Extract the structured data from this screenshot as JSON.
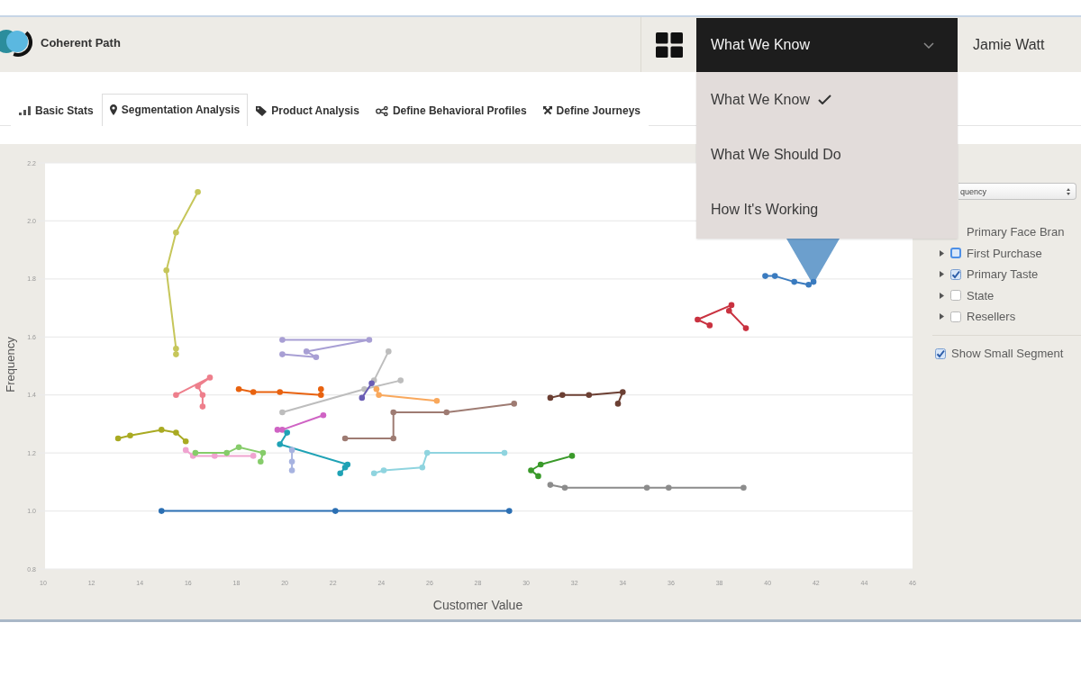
{
  "header": {
    "app_name": "Coherent Path",
    "view_menu": {
      "label": "What We Know",
      "expanded": true,
      "items": [
        {
          "label": "What We Know",
          "selected": true
        },
        {
          "label": "What We Should Do",
          "selected": false
        },
        {
          "label": "How It's Working",
          "selected": false
        }
      ]
    },
    "user_name": "Jamie Watt"
  },
  "tabs": [
    {
      "label": "Basic Stats",
      "selected": false
    },
    {
      "label": "Segmentation Analysis",
      "selected": true
    },
    {
      "label": "Product Analysis",
      "selected": false
    },
    {
      "label": "Define Behavioral Profiles",
      "selected": false
    },
    {
      "label": "Define Journeys",
      "selected": false
    }
  ],
  "chart": {
    "chart_data": {
      "type": "line",
      "xlabel": "Customer Value",
      "ylabel": "Frequency",
      "grid": true,
      "xlim": [
        10,
        46
      ],
      "ylim": [
        0.8,
        2.2
      ],
      "xticks": [
        10,
        12,
        14,
        16,
        18,
        20,
        22,
        24,
        26,
        28,
        30,
        32,
        34,
        36,
        38,
        40,
        42,
        44,
        46
      ],
      "yticks": [
        {
          "value": 0.8,
          "label": "0.8"
        },
        {
          "value": 1.0,
          "label": "1.0"
        },
        {
          "value": 1.2,
          "label": "1.2"
        },
        {
          "value": 1.4,
          "label": "1.4"
        },
        {
          "value": 1.6,
          "label": "1.6"
        },
        {
          "value": 1.8,
          "label": "1.8"
        },
        {
          "value": 2.0,
          "label": "2.0"
        },
        {
          "value": 2.2,
          "label": "2.2"
        }
      ],
      "series": [
        {
          "color": "#c6c65a",
          "marker": "circle",
          "x": [
            16.4,
            15.5,
            15.1,
            15.5,
            15.5
          ],
          "values": [
            2.1,
            1.96,
            1.83,
            1.56,
            1.54
          ]
        },
        {
          "color": "#2b6fb3",
          "marker": "circle",
          "x": [
            14.9,
            22.1,
            29.3
          ],
          "values": [
            1.0,
            1.0,
            1.0
          ]
        },
        {
          "color": "#a9aa22",
          "marker": "circle",
          "x": [
            13.1,
            13.6,
            14.9,
            15.5,
            15.9
          ],
          "values": [
            1.25,
            1.26,
            1.28,
            1.27,
            1.24
          ]
        },
        {
          "color": "#f0a3d0",
          "marker": "circle",
          "x": [
            15.9,
            16.2,
            17.1,
            18.7
          ],
          "values": [
            1.21,
            1.19,
            1.19,
            1.19
          ]
        },
        {
          "color": "#86cc6a",
          "marker": "circle",
          "x": [
            16.3,
            17.6,
            18.1,
            19.1,
            19.0
          ],
          "values": [
            1.2,
            1.2,
            1.22,
            1.2,
            1.17
          ]
        },
        {
          "color": "#ee7f8c",
          "marker": "circle",
          "x": [
            15.5,
            16.9,
            16.4,
            16.6,
            16.6
          ],
          "values": [
            1.4,
            1.46,
            1.43,
            1.4,
            1.36
          ]
        },
        {
          "color": "#e8620f",
          "marker": "circle",
          "x": [
            18.1,
            18.7,
            19.8,
            21.5,
            21.5
          ],
          "values": [
            1.42,
            1.41,
            1.41,
            1.4,
            1.42
          ]
        },
        {
          "color": "#a89fd4",
          "marker": "circle",
          "x": [
            19.9,
            23.5,
            20.9,
            21.3,
            19.9
          ],
          "values": [
            1.59,
            1.59,
            1.55,
            1.53,
            1.54
          ]
        },
        {
          "color": "#bdbdbd",
          "marker": "circle",
          "x": [
            19.9,
            23.3,
            24.8
          ],
          "values": [
            1.34,
            1.42,
            1.45
          ]
        },
        {
          "color": "#bdbdbd",
          "marker": "circle",
          "x": [
            23.7,
            24.3
          ],
          "values": [
            1.45,
            1.55
          ]
        },
        {
          "color": "#f9a85c",
          "marker": "circle",
          "x": [
            23.8,
            23.9,
            26.3
          ],
          "values": [
            1.42,
            1.4,
            1.38
          ]
        },
        {
          "color": "#6a5db5",
          "marker": "circle",
          "x": [
            23.6,
            23.2
          ],
          "values": [
            1.44,
            1.39
          ]
        },
        {
          "color": "#cf63c4",
          "marker": "circle",
          "x": [
            21.6,
            19.9,
            19.7
          ],
          "values": [
            1.33,
            1.28,
            1.28
          ]
        },
        {
          "color": "#1fa2b5",
          "marker": "circle",
          "x": [
            20.1,
            19.8,
            22.6,
            22.3,
            22.5
          ],
          "values": [
            1.27,
            1.23,
            1.16,
            1.13,
            1.15
          ]
        },
        {
          "color": "#a7b3e0",
          "marker": "circle",
          "x": [
            20.3,
            20.3,
            20.3
          ],
          "values": [
            1.21,
            1.17,
            1.14
          ]
        },
        {
          "color": "#8fd4df",
          "marker": "circle",
          "x": [
            23.7,
            24.1,
            25.7,
            25.9,
            29.1
          ],
          "values": [
            1.13,
            1.14,
            1.15,
            1.2,
            1.2
          ]
        },
        {
          "color": "#9e7b72",
          "marker": "circle",
          "x": [
            22.5,
            24.5,
            24.5,
            26.7,
            29.5
          ],
          "values": [
            1.25,
            1.25,
            1.34,
            1.34,
            1.37
          ]
        },
        {
          "color": "#6b3f33",
          "marker": "circle",
          "x": [
            31.0,
            31.5,
            32.6,
            34.0,
            33.8
          ],
          "values": [
            1.39,
            1.4,
            1.4,
            1.41,
            1.37
          ]
        },
        {
          "color": "#3a9a2a",
          "marker": "circle",
          "x": [
            30.5,
            30.2,
            30.6,
            31.9
          ],
          "values": [
            1.12,
            1.14,
            1.16,
            1.19
          ]
        },
        {
          "color": "#8c8c8c",
          "marker": "circle",
          "x": [
            31.0,
            31.6,
            35.0,
            35.9,
            39.0
          ],
          "values": [
            1.09,
            1.08,
            1.08,
            1.08,
            1.08
          ]
        },
        {
          "color": "#c93240",
          "marker": "circle",
          "x": [
            37.6,
            37.1,
            38.5,
            38.4,
            39.1
          ],
          "values": [
            1.64,
            1.66,
            1.71,
            1.69,
            1.63
          ]
        },
        {
          "color": "#3a7bbf",
          "marker": "circle",
          "x": [
            39.9,
            40.3,
            41.1,
            41.7,
            41.9
          ],
          "values": [
            1.81,
            1.81,
            1.79,
            1.78,
            1.79
          ]
        }
      ]
    }
  },
  "side_panel": {
    "select": {
      "value": "quency"
    },
    "attributes": [
      {
        "label": "Primary Face Bran"
      },
      {
        "label": "First Purchase",
        "expanded": false,
        "checked": false,
        "focused": true
      },
      {
        "label": "Primary Taste",
        "expanded": false,
        "checked": true,
        "focused": false
      },
      {
        "label": "State",
        "expanded": false,
        "checked": false,
        "focused": false
      },
      {
        "label": "Resellers",
        "expanded": false,
        "checked": false,
        "focused": false
      }
    ],
    "show_small_segments": {
      "label": "Show Small Segment",
      "checked": true
    }
  }
}
